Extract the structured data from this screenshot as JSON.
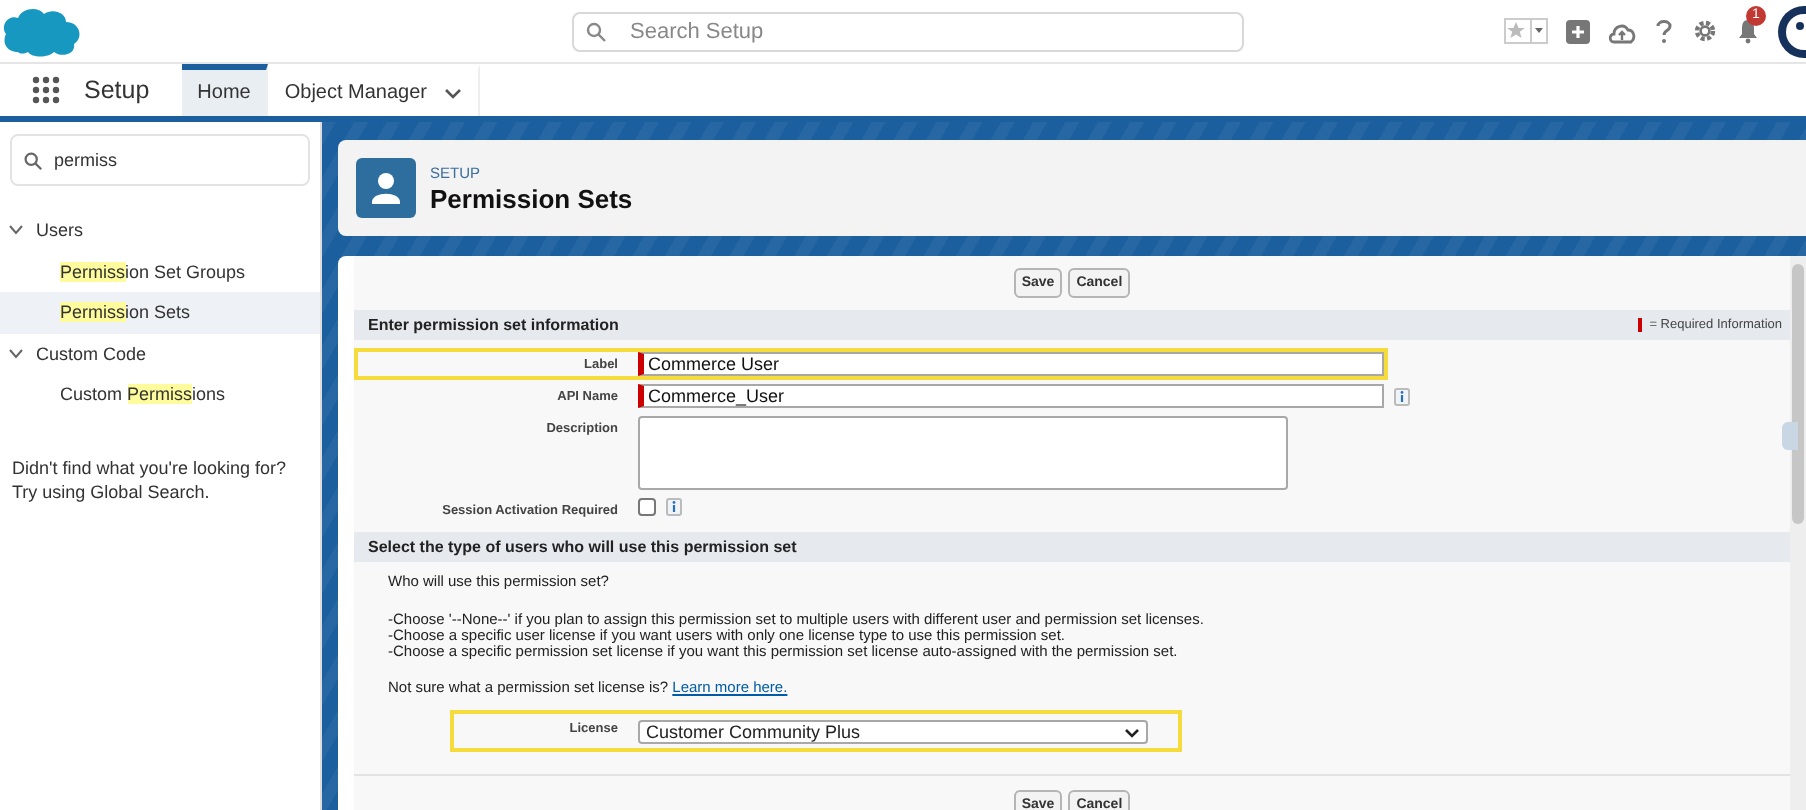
{
  "header": {
    "search": {
      "placeholder": "Search Setup"
    },
    "notifications": {
      "badge": "1"
    }
  },
  "nav": {
    "app_name": "Setup",
    "tabs": [
      {
        "label": "Home",
        "selected": true,
        "menu": false
      },
      {
        "label": "Object Manager",
        "selected": false,
        "menu": true
      }
    ]
  },
  "sidebar": {
    "search": {
      "value": "permiss"
    },
    "items": [
      {
        "label": "Users",
        "expanded": true,
        "children": [
          {
            "label": "**Permiss**ion Set Groups",
            "selected": false
          },
          {
            "label": "**Permiss**ion Sets",
            "selected": true
          }
        ]
      },
      {
        "label": "Custom Code",
        "expanded": true,
        "children": [
          {
            "label": "Custom **Permiss**ions",
            "selected": false
          }
        ]
      }
    ],
    "help": [
      "Didn't find what you're looking for?",
      "Try using Global Search."
    ]
  },
  "page_header": {
    "eyebrow": "SETUP",
    "title": "Permission Sets"
  },
  "form": {
    "buttons": [
      "Save",
      "Cancel"
    ],
    "sections": [
      {
        "title": "Enter permission set information",
        "legend": "= Required Information",
        "fields": [
          {
            "kind": "text",
            "label": "Label",
            "value": "Commerce User",
            "required": true,
            "info": false,
            "highlighted": true
          },
          {
            "kind": "text",
            "label": "API Name",
            "value": "Commerce_User",
            "required": true,
            "info": true,
            "highlighted": false
          },
          {
            "kind": "textarea",
            "label": "Description",
            "required": false,
            "info": false,
            "highlighted": false
          },
          {
            "kind": "checkbox",
            "label": "Session Activation Required",
            "checked": false,
            "required": false,
            "info": true,
            "highlighted": false
          }
        ]
      },
      {
        "title": "Select the type of users who will use this permission set",
        "paragraphs": [
          [
            "Who will use this permission set?"
          ],
          [
            "-Choose '--None--' if you plan to assign this permission set to multiple users with different user and permission set licenses.",
            "-Choose a specific user license if you want users with only one license type to use this permission set.",
            "-Choose a specific permission set license if you want this permission set license auto-assigned with the permission set."
          ]
        ],
        "link_line": {
          "text": "Not sure what a permission set license is?",
          "link": "Learn more here."
        },
        "fields": [
          {
            "kind": "select",
            "label": "License",
            "value": "Customer Community Plus",
            "required": false,
            "info": false,
            "highlighted": true
          }
        ]
      }
    ],
    "bottom_buttons": [
      "Save",
      "Cancel"
    ]
  }
}
